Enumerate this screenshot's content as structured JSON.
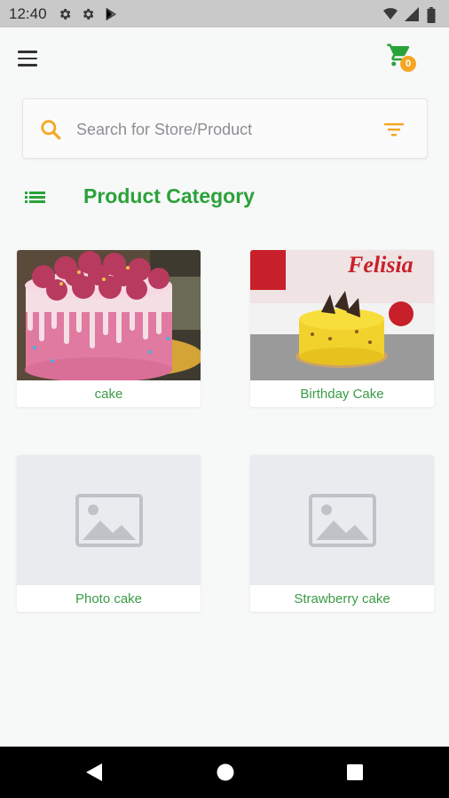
{
  "status_bar": {
    "time": "12:40",
    "left_icons": [
      "gear-icon",
      "gear-icon",
      "play-store-icon"
    ],
    "right_icons": [
      "wifi-icon",
      "signal-icon",
      "battery-icon"
    ]
  },
  "app_bar": {
    "menu_icon": "hamburger-menu-icon",
    "cart_icon": "shopping-cart-icon",
    "cart_count": "0"
  },
  "search": {
    "placeholder": "Search for Store/Product",
    "value": ""
  },
  "category_section": {
    "title": "Product Category"
  },
  "categories": [
    {
      "label": "cake",
      "image": "pink-drip-cake-photo"
    },
    {
      "label": "Birthday Cake",
      "image": "yellow-chocolate-cake-photo"
    },
    {
      "label": "Photo cake",
      "image": "image-placeholder-icon"
    },
    {
      "label": "Strawberry cake",
      "image": "image-placeholder-icon"
    }
  ],
  "photo_text": {
    "brand": "Felisia"
  },
  "colors": {
    "accent_green": "#2aa23a",
    "accent_orange": "#f5a623",
    "status_bar": "#c9c9c9",
    "nav_bar": "#000000"
  },
  "nav_bar": {
    "buttons": [
      "back-icon",
      "home-icon",
      "recents-icon"
    ]
  }
}
